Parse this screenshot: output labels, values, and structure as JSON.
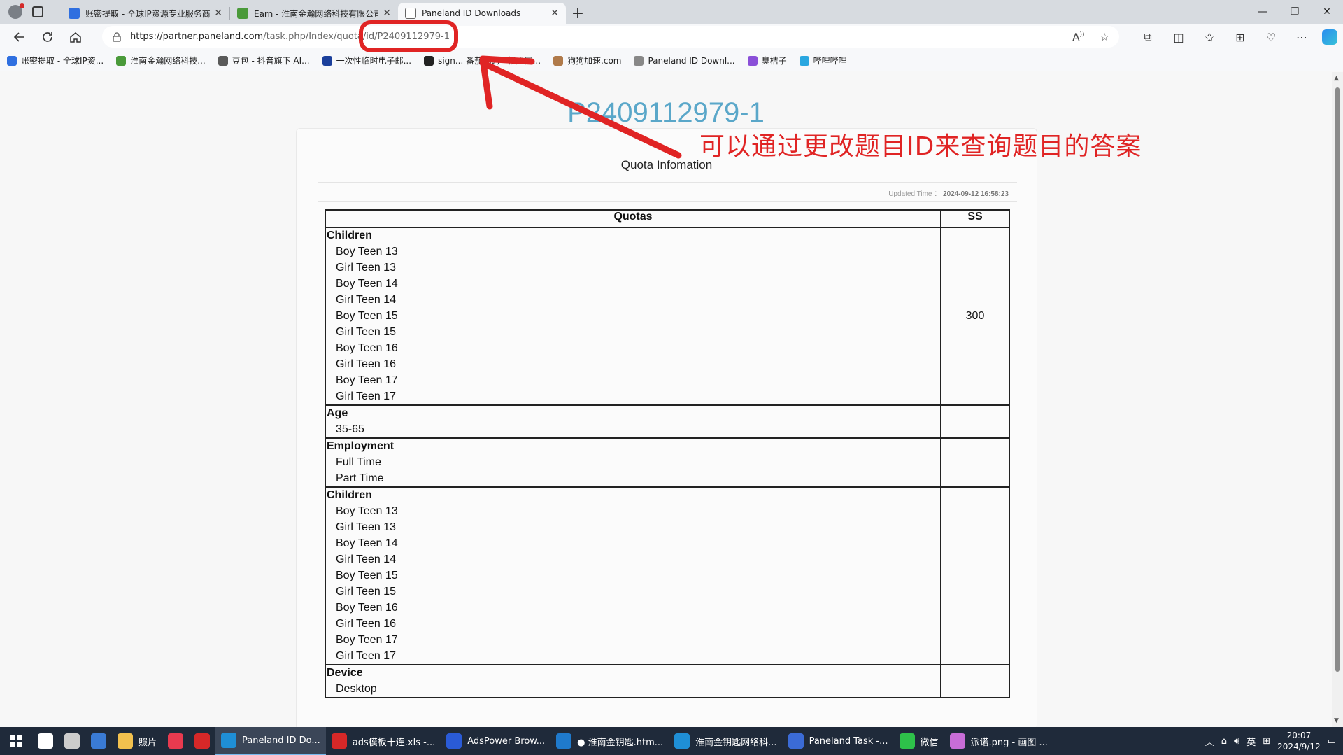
{
  "browser": {
    "tabs": [
      {
        "title": "账密提取 - 全球IP资源专业服务商",
        "color": "#2f6fe0",
        "active": false
      },
      {
        "title": "Earn - 淮南金瀚网络科技有限公司",
        "color": "#4a9a3a",
        "active": false
      },
      {
        "title": "Paneland ID Downloads",
        "color": "#ffffff",
        "active": true
      }
    ],
    "new_tab": "+",
    "window_controls": {
      "minimize": "—",
      "restore": "❐",
      "close": "✕"
    },
    "url_host": "https://partner.paneland.com",
    "url_path": "/task.php/Index/quota/id/P2409112979-1",
    "bookmarks": [
      {
        "label": "账密提取 - 全球IP资...",
        "color": "#2f6fe0"
      },
      {
        "label": "淮南金瀚网络科技...",
        "color": "#4a9a3a"
      },
      {
        "label": "豆包 - 抖音旗下 AI...",
        "color": "#5a5a5a"
      },
      {
        "label": "一次性临时电子邮...",
        "color": "#1b3f9b"
      },
      {
        "label": "sign...    番茄代码 · 帐户国...",
        "color": "#222222"
      },
      {
        "label": "狗狗加速.com",
        "color": "#b07a4a"
      },
      {
        "label": "Paneland ID Downl...",
        "color": "#888888"
      },
      {
        "label": "臭桔子",
        "color": "#8a4fd8"
      },
      {
        "label": "哔哩哔哩",
        "color": "#2aa7e0"
      }
    ]
  },
  "page": {
    "id_heading": "P2409112979-1",
    "card_title": "Quota Infomation",
    "updated_label": "Updated Time ：",
    "updated_value": "2024-09-12 16:58:23",
    "table": {
      "col_quotas": "Quotas",
      "col_ss": "SS",
      "groups": [
        {
          "title": "Children",
          "items": [
            "Boy Teen 13",
            "Girl Teen 13",
            "Boy Teen 14",
            "Girl Teen 14",
            "Boy Teen 15",
            "Girl Teen 15",
            "Boy Teen 16",
            "Girl Teen 16",
            "Boy Teen 17",
            "Girl Teen 17"
          ],
          "ss": "300"
        },
        {
          "title": "Age",
          "items": [
            "35-65"
          ],
          "ss": ""
        },
        {
          "title": "Employment",
          "items": [
            "Full Time",
            "Part Time"
          ],
          "ss": ""
        },
        {
          "title": "Children",
          "items": [
            "Boy Teen 13",
            "Girl Teen 13",
            "Boy Teen 14",
            "Girl Teen 14",
            "Boy Teen 15",
            "Girl Teen 15",
            "Boy Teen 16",
            "Girl Teen 16",
            "Boy Teen 17",
            "Girl Teen 17"
          ],
          "ss": ""
        },
        {
          "title": "Device",
          "items": [
            "Desktop"
          ],
          "ss": ""
        }
      ]
    }
  },
  "annotation": {
    "text": "可以通过更改题目ID来查询题目的答案",
    "color": "#e02424"
  },
  "taskbar": {
    "items": [
      {
        "label": "",
        "color": "#ffffff"
      },
      {
        "label": "",
        "color": "#cccccc"
      },
      {
        "label": "",
        "color": "#3a7bd5"
      },
      {
        "label": "照片",
        "color": "#f2c14e"
      },
      {
        "label": "",
        "color": "#e83a4f"
      },
      {
        "label": "",
        "color": "#d62828"
      },
      {
        "label": "Paneland ID Do...",
        "color": "#1f8fd6",
        "active": true
      },
      {
        "label": "ads模板十连.xls -...",
        "color": "#d62828"
      },
      {
        "label": "AdsPower Brow...",
        "color": "#2a5bd7"
      },
      {
        "label": "● 淮南金钥匙.htm...",
        "color": "#1f7acc"
      },
      {
        "label": "淮南金钥匙网络科...",
        "color": "#1f8fd6"
      },
      {
        "label": "Paneland Task -...",
        "color": "#3b6bd6"
      },
      {
        "label": "微信",
        "color": "#2ec14a"
      },
      {
        "label": "派诺.png - 画图 ...",
        "color": "#c86dd7"
      }
    ],
    "tray_lang": "英",
    "clock_time": "20:07",
    "clock_date": "2024/9/12"
  }
}
